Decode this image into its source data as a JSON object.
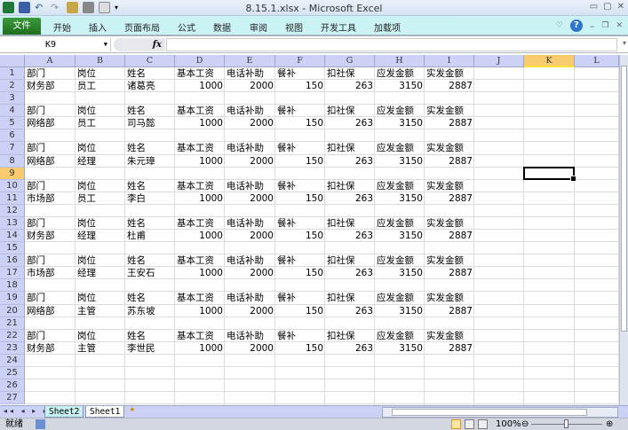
{
  "window": {
    "title": "8.15.1.xlsx - Microsoft Excel"
  },
  "ribbon": {
    "file": "文件",
    "tabs": [
      "开始",
      "插入",
      "页面布局",
      "公式",
      "数据",
      "审阅",
      "视图",
      "开发工具",
      "加载项"
    ]
  },
  "formula_bar": {
    "name_box": "K9",
    "fx": "fx",
    "value": ""
  },
  "columns": [
    "A",
    "B",
    "C",
    "D",
    "E",
    "F",
    "G",
    "H",
    "I",
    "J",
    "K",
    "L"
  ],
  "selected_cell": {
    "col": "K",
    "row": 9
  },
  "headers": [
    "部门",
    "岗位",
    "姓名",
    "基本工资",
    "电话补助",
    "餐补",
    "扣社保",
    "应发金额",
    "实发金额"
  ],
  "records": [
    {
      "dept": "财务部",
      "pos": "员工",
      "name": "诸葛亮",
      "base": 1000,
      "phone": 2000,
      "meal": 150,
      "ins": 263,
      "gross": 3150,
      "net": 2887
    },
    {
      "dept": "网络部",
      "pos": "员工",
      "name": "司马懿",
      "base": 1000,
      "phone": 2000,
      "meal": 150,
      "ins": 263,
      "gross": 3150,
      "net": 2887
    },
    {
      "dept": "网络部",
      "pos": "经理",
      "name": "朱元璋",
      "base": 1000,
      "phone": 2000,
      "meal": 150,
      "ins": 263,
      "gross": 3150,
      "net": 2887
    },
    {
      "dept": "市场部",
      "pos": "员工",
      "name": "李白",
      "base": 1000,
      "phone": 2000,
      "meal": 150,
      "ins": 263,
      "gross": 3150,
      "net": 2887
    },
    {
      "dept": "财务部",
      "pos": "经理",
      "name": "杜甫",
      "base": 1000,
      "phone": 2000,
      "meal": 150,
      "ins": 263,
      "gross": 3150,
      "net": 2887
    },
    {
      "dept": "市场部",
      "pos": "经理",
      "name": "王安石",
      "base": 1000,
      "phone": 2000,
      "meal": 150,
      "ins": 263,
      "gross": 3150,
      "net": 2887
    },
    {
      "dept": "网络部",
      "pos": "主管",
      "name": "苏东坡",
      "base": 1000,
      "phone": 2000,
      "meal": 150,
      "ins": 263,
      "gross": 3150,
      "net": 2887
    },
    {
      "dept": "财务部",
      "pos": "主管",
      "name": "李世民",
      "base": 1000,
      "phone": 2000,
      "meal": 150,
      "ins": 263,
      "gross": 3150,
      "net": 2887
    }
  ],
  "sheets": [
    "Sheet2",
    "Sheet1"
  ],
  "active_sheet": "Sheet1",
  "status": {
    "ready": "就绪",
    "zoom": "100%"
  }
}
